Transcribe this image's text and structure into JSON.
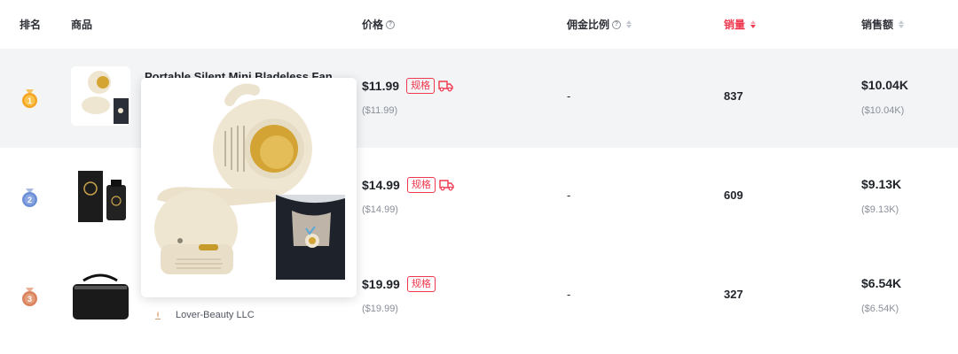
{
  "header": {
    "rank": "排名",
    "product": "商品",
    "price": "价格",
    "commission": "佣金比例",
    "sales": "销量",
    "revenue": "销售额"
  },
  "rows": [
    {
      "rank": "1",
      "medal_color": "#f5a524",
      "name": "Portable Silent Mini Bladeless Fan",
      "price": "$11.99",
      "price_sub": "($11.99)",
      "spec_label": "规格",
      "commission": "-",
      "sales": "837",
      "revenue": "$10.04K",
      "revenue_sub": "($10.04K)",
      "has_shipping_icon": true
    },
    {
      "rank": "2",
      "medal_color": "#6b8fd6",
      "price": "$14.99",
      "price_sub": "($14.99)",
      "spec_label": "规格",
      "commission": "-",
      "sales": "609",
      "revenue": "$9.13K",
      "revenue_sub": "($9.13K)",
      "has_shipping_icon": true
    },
    {
      "rank": "3",
      "medal_color": "#d9825b",
      "shop": "Lover-Beauty LLC",
      "price": "$19.99",
      "price_sub": "($19.99)",
      "spec_label": "规格",
      "commission": "-",
      "sales": "327",
      "revenue": "$6.54K",
      "revenue_sub": "($6.54K)",
      "has_shipping_icon": false
    }
  ],
  "icons": {
    "help": "question-circle-icon",
    "sort": "sort-caret-icon",
    "shipping": "delivery-truck-icon"
  },
  "colors": {
    "accent": "#f0384e",
    "muted": "#8a8f99",
    "row_highlight": "#f3f4f6"
  }
}
